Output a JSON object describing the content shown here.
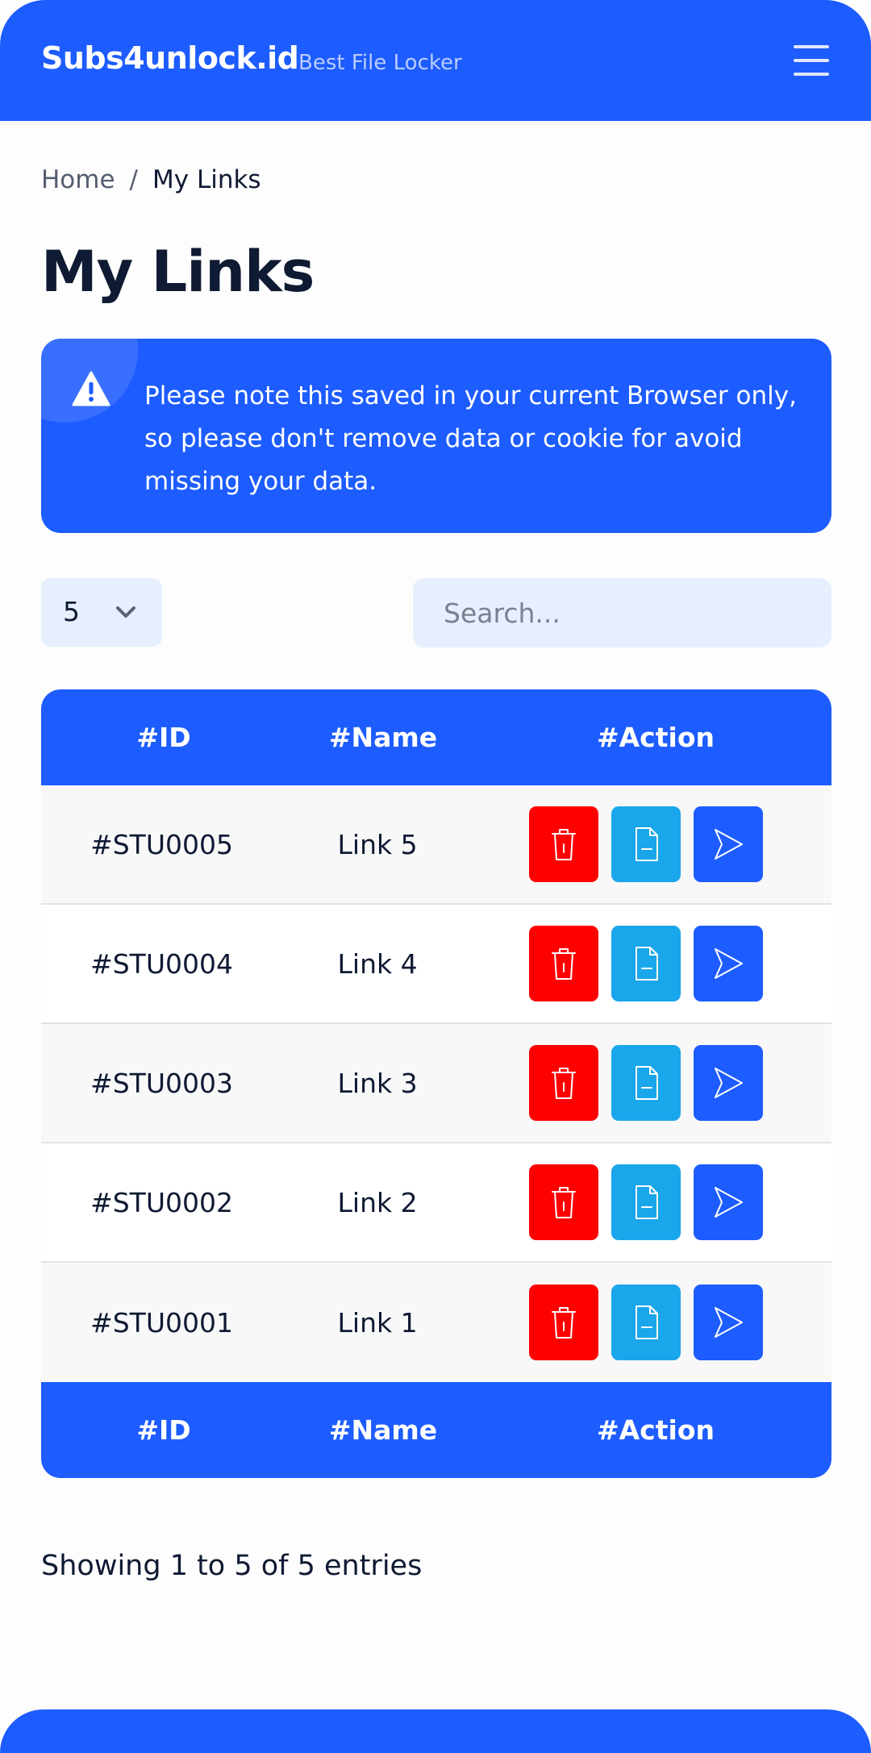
{
  "header": {
    "brand": "Subs4unlock.id",
    "tagline": "Best File Locker"
  },
  "breadcrumb": {
    "home": "Home",
    "separator": "/",
    "current": "My Links"
  },
  "page_title": "My Links",
  "alert": {
    "text": "Please note this saved in your current Browser only, so please don't remove data or cookie for avoid missing your data."
  },
  "controls": {
    "length_value": "5",
    "search_placeholder": "Search..."
  },
  "table": {
    "columns": [
      "#ID",
      "#Name",
      "#Action"
    ],
    "rows": [
      {
        "id": "#STU0005",
        "name": "Link 5"
      },
      {
        "id": "#STU0004",
        "name": "Link 4"
      },
      {
        "id": "#STU0003",
        "name": "Link 3"
      },
      {
        "id": "#STU0002",
        "name": "Link 2"
      },
      {
        "id": "#STU0001",
        "name": "Link 1"
      }
    ]
  },
  "entries_info": "Showing 1 to 5 of 5 entries",
  "icons": {
    "menu": "hamburger-menu-icon",
    "alert": "warning-icon",
    "select": "chevron-down-icon",
    "delete": "trash-icon",
    "copy": "document-icon",
    "open": "play-arrow-icon"
  },
  "colors": {
    "primary": "#1d5cff",
    "delete": "#ff0000",
    "copy": "#1aa6ea",
    "input_bg": "#e7efff"
  }
}
